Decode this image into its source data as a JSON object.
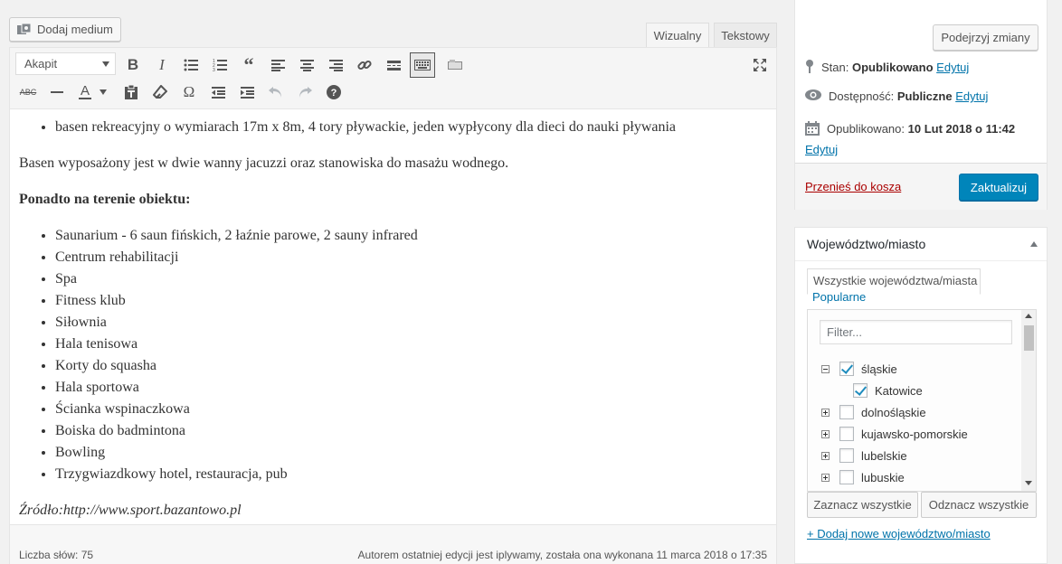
{
  "editor": {
    "add_media_label": "Dodaj medium",
    "tab_visual": "Wizualny",
    "tab_text": "Tekstowy",
    "format_select": "Akapit",
    "content": {
      "list_top": [
        "basen rekreacyjny o wymiarach 17m x 8m, 4 tory pływackie, jeden wypłycony dla dieci do nauki pływania"
      ],
      "paragraph": "Basen wyposażony jest w dwie wanny jacuzzi oraz stanowiska do masażu wodnego.",
      "heading": "Ponadto na terenie obiektu:",
      "list_main": [
        "Saunarium - 6 saun fińskich, 2 łaźnie parowe, 2 sauny infrared",
        "Centrum rehabilitacji",
        "Spa",
        "Fitness klub",
        "Siłownia",
        "Hala tenisowa",
        "Korty do squasha",
        "Hala sportowa",
        "Ścianka wspinaczkowa",
        "Boiska do badmintona",
        "Bowling",
        "Trzygwiazdkowy hotel, restauracja, pub"
      ],
      "source": "Źródło:http://www.sport.bazantowo.pl"
    },
    "word_count": "Liczba słów: 75",
    "last_edit": "Autorem ostatniej edycji jest iplywamy, została ona wykonana 11 marca 2018 o 17:35"
  },
  "publish": {
    "preview_label": "Podejrzyj zmiany",
    "status_label": "Stan:",
    "status_value": "Opublikowano",
    "visibility_label": "Dostępność:",
    "visibility_value": "Publiczne",
    "published_label": "Opublikowano:",
    "published_value": "10 Lut 2018 o 11:42",
    "edit_link": "Edytuj",
    "trash_label": "Przenieś do kosza",
    "update_label": "Zaktualizuj"
  },
  "region": {
    "title": "Województwo/miasto",
    "tab_all": "Wszystkie województwa/miasta",
    "tab_popular": "Popularne",
    "filter_placeholder": "Filter...",
    "items": [
      {
        "label": "śląskie",
        "checked": true,
        "expanded": true
      },
      {
        "label": "Katowice",
        "checked": true,
        "child": true
      },
      {
        "label": "dolnośląskie",
        "checked": false
      },
      {
        "label": "kujawsko-pomorskie",
        "checked": false
      },
      {
        "label": "lubelskie",
        "checked": false
      },
      {
        "label": "lubuskie",
        "checked": false
      }
    ],
    "select_all_label": "Zaznacz wszystkie",
    "deselect_all_label": "Odznacz wszystkie",
    "add_new_label": "+ Dodaj nowe województwo/miasto"
  }
}
